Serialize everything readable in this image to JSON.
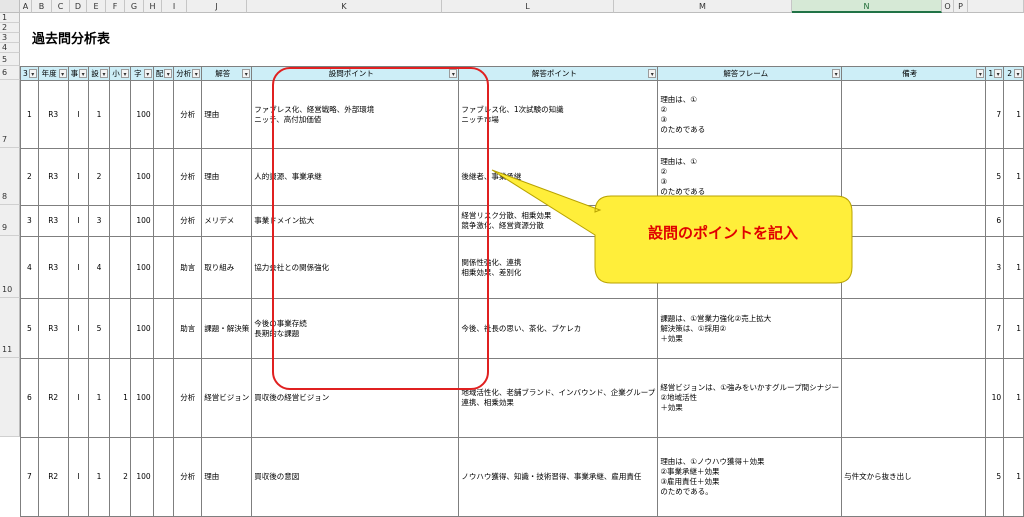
{
  "columns": [
    "A",
    "B",
    "C",
    "D",
    "E",
    "F",
    "G",
    "H",
    "I",
    "J",
    "K",
    "L",
    "M",
    "N",
    "O",
    "P"
  ],
  "selected_column": "N",
  "rows": [
    "1",
    "2",
    "3",
    "4",
    "5",
    "6",
    "7",
    "8",
    "9",
    "10",
    "11"
  ],
  "title": "過去問分析表",
  "headers": [
    "3",
    "年度",
    "事",
    "設",
    "小",
    "字",
    "配",
    "分析",
    "解答",
    "設問ポイント",
    "解答ポイント",
    "解答フレーム",
    "備考",
    "1",
    "2"
  ],
  "filter_glyph": "▾",
  "data_rows": [
    [
      "1",
      "R3",
      "I",
      "1",
      "",
      "100",
      "",
      "分析",
      "理由",
      "ファブレス化、経営戦略、外部環境\nニッチ、高付加価値",
      "ファブレス化、1次試験の知識\nニッチ市場",
      "理由は、①\n②\n③\nのためである",
      "",
      "7",
      "1"
    ],
    [
      "2",
      "R3",
      "I",
      "2",
      "",
      "100",
      "",
      "分析",
      "理由",
      "人的資源、事業承継",
      "後継者、事業承継",
      "理由は、①\n②\n③\nのためである",
      "",
      "5",
      "1"
    ],
    [
      "3",
      "R3",
      "I",
      "3",
      "",
      "100",
      "",
      "分析",
      "メリデメ",
      "事業ドメイン拡大",
      "経営リスク分散、相乗効果\n競争激化、経営資源分散",
      "",
      "",
      "6",
      ""
    ],
    [
      "4",
      "R3",
      "I",
      "4",
      "",
      "100",
      "",
      "助言",
      "取り組み",
      "協力会社との関係強化",
      "関係性強化、連携\n相乗効果、差別化",
      "",
      "",
      "3",
      "1"
    ],
    [
      "5",
      "R3",
      "I",
      "5",
      "",
      "100",
      "",
      "助言",
      "課題・解決策",
      "今後の事業存続\n長期的な課題",
      "今後、社長の思い、茶化、ブケレカ",
      "課題は、①営業力強化②売上拡大\n解決策は、①採用②\n＋効果",
      "",
      "7",
      "1"
    ],
    [
      "6",
      "R2",
      "I",
      "1",
      "1",
      "100",
      "",
      "分析",
      "経営ビジョン",
      "買収後の経営ビジョン",
      "地域活性化、老舗ブランド、インバウンド、企業グループ\n連携、相乗効果",
      "経営ビジョンは、①強みをいかすグループ間シナジー\n②地域活性\n＋効果",
      "",
      "10",
      "1"
    ],
    [
      "7",
      "R2",
      "I",
      "1",
      "2",
      "100",
      "",
      "分析",
      "理由",
      "買収後の意図",
      "ノウハウ獲得、知識・技術習得、事業承継、雇用責任",
      "理由は、①ノウハウ獲得＋効果\n②事業承継＋効果\n③雇用責任＋効果\nのためである。",
      "与件文から抜き出し",
      "5",
      "1"
    ]
  ],
  "callout": {
    "text": "設問のポイントを記入",
    "fill": "#ffee3a",
    "stroke": "#b8a200"
  },
  "accent_red": "#e02020",
  "header_fill": "#cdeef7"
}
